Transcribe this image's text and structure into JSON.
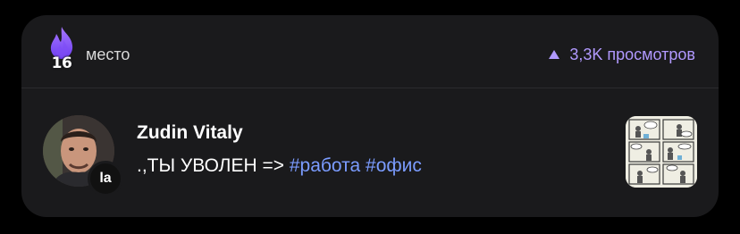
{
  "rank": {
    "number": "16",
    "label": "место",
    "icon": "fire-icon",
    "accent_color": "#8a5cf6"
  },
  "views": {
    "icon": "triangle-up-icon",
    "text": "3,3K просмотров",
    "color": "#b199ff"
  },
  "post": {
    "author": "Zudin Vitaly",
    "title_prefix": ".,ТЫ УВОЛЕН =>",
    "hashtags": [
      "#работа",
      "#офис"
    ],
    "hashtag_color": "#7b9cff",
    "badge_text": "la",
    "thumbnail_icon": "comic-thumbnail"
  }
}
